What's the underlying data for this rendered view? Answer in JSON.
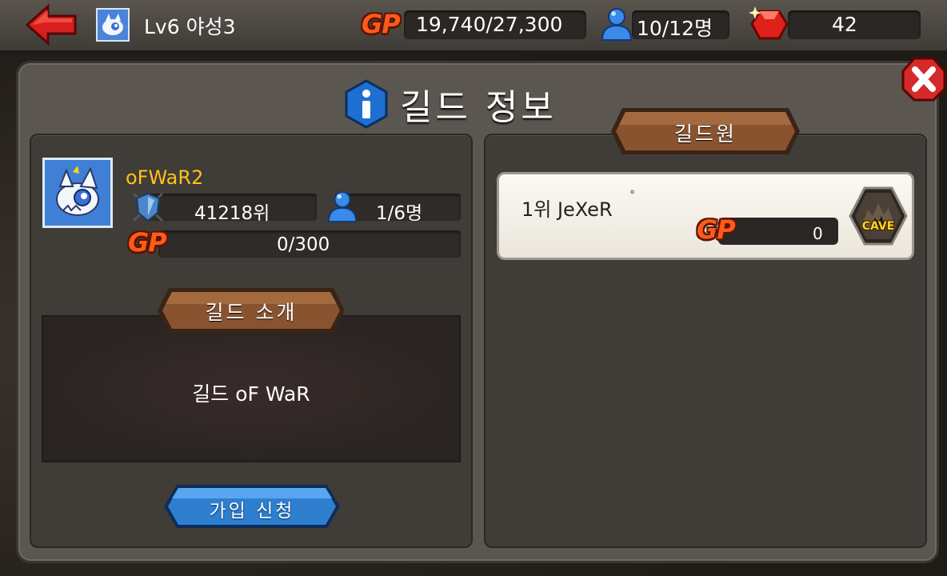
{
  "topbar": {
    "level_label": "Lv6 야성3",
    "gp_logo": "GP",
    "gp_value": "19,740/27,300",
    "members_value": "10/12명",
    "gems_value": "42"
  },
  "dialog": {
    "title": "길드 정보"
  },
  "guild": {
    "name": "oFWaR2",
    "rank": "41218위",
    "members": "1/6명",
    "gp_logo": "GP",
    "gp": "0/300",
    "intro_header": "길드 소개",
    "intro_text": "길드 oF WaR",
    "join_button": "가입 신청"
  },
  "members_panel": {
    "header": "길드원",
    "members": [
      {
        "name": "1위 JeXeR",
        "mark": "°",
        "gp_logo": "GP",
        "gp": "0",
        "badge": "CAVE"
      }
    ]
  },
  "colors": {
    "gp_orange": "#ff5a1a",
    "guild_name": "#ffc21a",
    "ribbon_brown": "#7a4a2a",
    "join_blue": "#2f7fd0",
    "close_red": "#d42a2a"
  },
  "icons": [
    "back-arrow-icon",
    "dragon-avatar-icon",
    "person-icon",
    "gem-icon",
    "close-icon",
    "info-icon",
    "shield-icon",
    "cave-icon"
  ]
}
